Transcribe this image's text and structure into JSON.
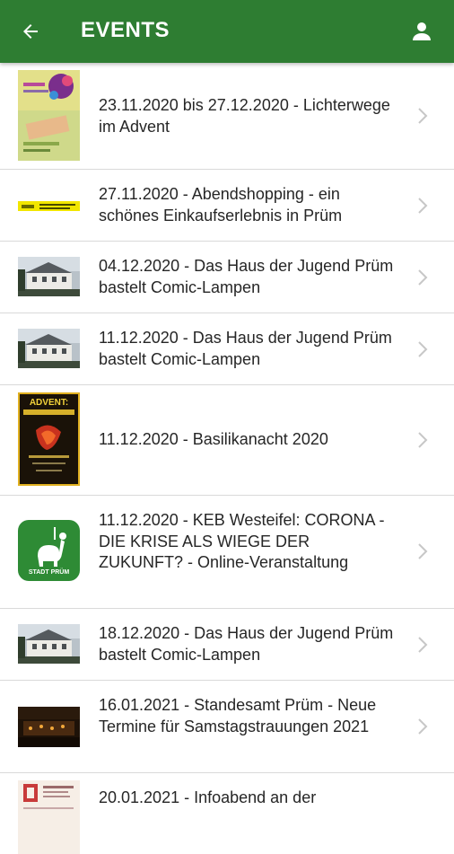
{
  "appbar": {
    "title": "EVENTS",
    "back_icon": "arrow-left-icon",
    "account_icon": "person-icon",
    "color": "#2e7d32"
  },
  "events": [
    {
      "label": "23.11.2020 bis 27.12.2020 - Lichterwege im Advent",
      "thumb": "flyer-colorful"
    },
    {
      "label": "27.11.2020 - Abendshopping - ein schönes Einkaufserlebnis in Prüm",
      "thumb": "yellow-banner"
    },
    {
      "label": "04.12.2020 - Das Haus der Jugend Prüm bastelt Comic-Lampen",
      "thumb": "house-photo"
    },
    {
      "label": "11.12.2020 - Das Haus der Jugend Prüm bastelt Comic-Lampen",
      "thumb": "house-photo"
    },
    {
      "label": "11.12.2020 - Basilikanacht 2020",
      "thumb": "advent-poster",
      "thumb_text": "ADVENT:"
    },
    {
      "label": "11.12.2020 - KEB Westeifel: CORONA - DIE KRISE ALS WIEGE DER ZUKUNFT? - Online-Veranstaltung",
      "thumb": "city-logo",
      "thumb_text": "STADT PRÜM"
    },
    {
      "label": "18.12.2020 - Das Haus der Jugend Prüm bastelt Comic-Lampen",
      "thumb": "house-photo"
    },
    {
      "label": "16.01.2021 - Standesamt Prüm - Neue Termine für Samstagstrauungen 2021",
      "thumb": "night-photo"
    },
    {
      "label": "20.01.2021 - Infoabend an der",
      "thumb": "document-thumb"
    }
  ]
}
